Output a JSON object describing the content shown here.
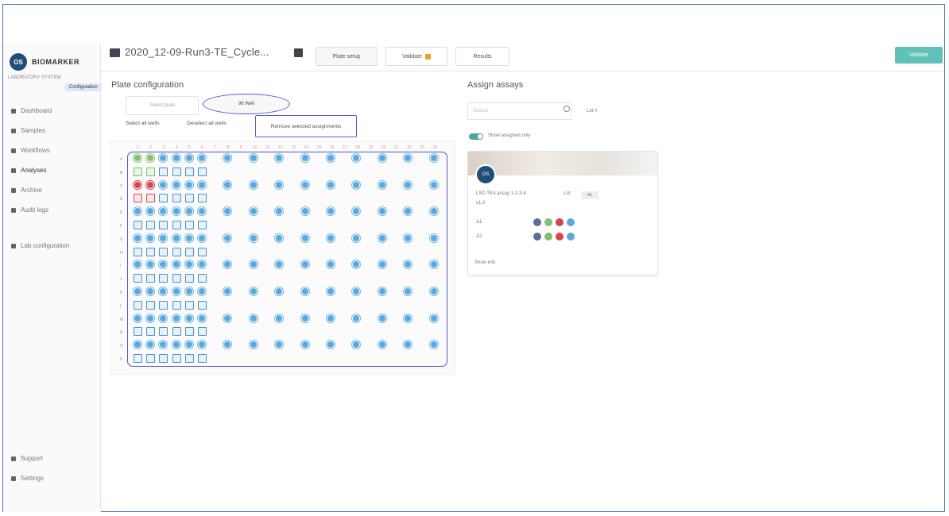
{
  "app": {
    "logo_text": "BIOMARKER",
    "logo_mark": "OS",
    "org_text": "LABORATORY SYSTEM",
    "org_badge": "Configuration"
  },
  "sidebar": {
    "items": [
      {
        "label": "Dashboard",
        "icon": "dashboard-icon"
      },
      {
        "label": "Samples",
        "icon": "samples-icon"
      },
      {
        "label": "Workflows",
        "icon": "workflows-icon"
      },
      {
        "label": "Analyses",
        "icon": "analyses-icon"
      },
      {
        "label": "Archive",
        "icon": "archive-icon"
      },
      {
        "label": "Audit logs",
        "icon": "audit-icon"
      },
      {
        "label": "Lab configuration",
        "icon": "lab-config-icon"
      }
    ],
    "bottom": [
      {
        "label": "Support",
        "icon": "support-icon"
      },
      {
        "label": "Settings",
        "icon": "settings-icon"
      }
    ]
  },
  "header": {
    "title": "2020_12-09-Run3-TE_Cycle...",
    "tabs": [
      {
        "label": "Plate setup"
      },
      {
        "label": "Validate"
      },
      {
        "label": "Results"
      }
    ],
    "action_label": "Validate"
  },
  "plate_config": {
    "heading": "Plate configuration",
    "select_placeholder": "Select plate",
    "selected_value": "96 Well",
    "actions": [
      "Select all wells",
      "Deselect all wells",
      "Remove selected assignments"
    ]
  },
  "plate": {
    "columns": [
      "1",
      "2",
      "3",
      "4",
      "5",
      "6",
      "7",
      "8",
      "9",
      "10",
      "11",
      "12",
      "13",
      "14",
      "15",
      "16",
      "17",
      "18",
      "19",
      "20",
      "21",
      "22",
      "23",
      "24"
    ],
    "rows": [
      "A",
      "B",
      "C",
      "D",
      "E",
      "F",
      "G",
      "H",
      "I",
      "J",
      "K",
      "L",
      "M",
      "N",
      "O",
      "P"
    ]
  },
  "assign": {
    "heading": "Assign assays",
    "search_placeholder": "Search",
    "search_extra": "Lot #",
    "toggle_label": "Show assigned only",
    "card": {
      "title_line": "LSD TEA assay 1-2-3-4",
      "title_tag": "Lot",
      "sub": "v1.0",
      "rows": [
        {
          "label": "A1",
          "dots": [
            "#5a6f9a",
            "#80c070",
            "#d8434e",
            "#5aa9de"
          ]
        },
        {
          "label": "A2",
          "dots": [
            "#5a6f9a",
            "#80c070",
            "#d8434e",
            "#5aa9de"
          ]
        }
      ],
      "footer": "Show info"
    }
  },
  "colors": {
    "accent": "#5fc1b7",
    "well_blue": "#5aa9de",
    "well_green": "#80c070",
    "well_red": "#d8434e",
    "annotation": "#4f5bd0"
  }
}
